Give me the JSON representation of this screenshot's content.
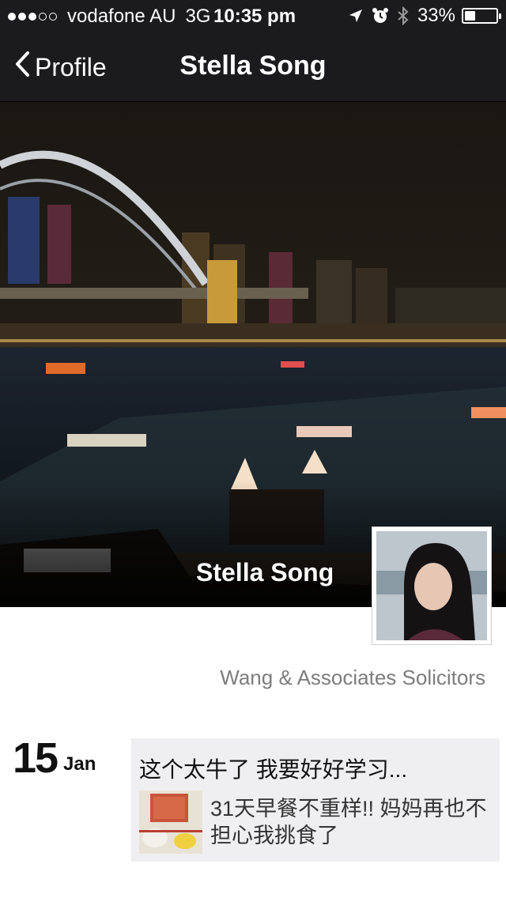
{
  "status_bar": {
    "carrier": "vodafone AU",
    "network": "3G",
    "time": "10:35 pm",
    "battery": "33%",
    "battery_level": 0.33,
    "signal_bars_filled": 3,
    "signal_bars_total": 5
  },
  "nav": {
    "back_label": "Profile",
    "title": "Stella Song"
  },
  "profile": {
    "name": "Stella Song",
    "company": "Wang & Associates Solicitors"
  },
  "feed": [
    {
      "day": "15",
      "month": "Jan",
      "text": "这个太牛了 我要好好学习...",
      "link_title": "31天早餐不重样!! 妈妈再也不担心我挑食了"
    }
  ],
  "icons": {
    "back": "chevron-left-icon",
    "location": "location-arrow-icon",
    "alarm": "alarm-clock-icon",
    "bluetooth": "bluetooth-icon",
    "battery": "battery-icon"
  }
}
